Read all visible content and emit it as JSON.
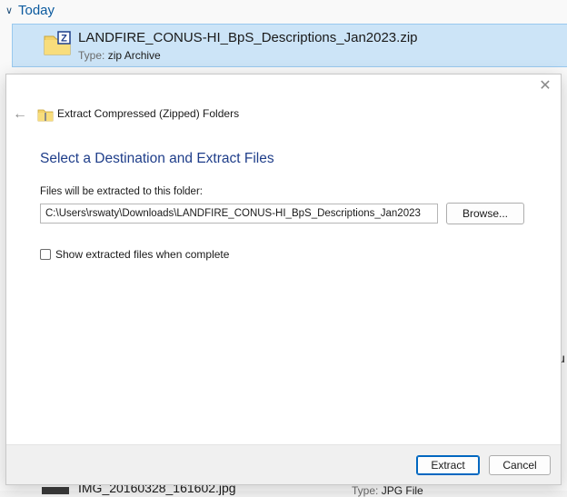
{
  "explorer": {
    "group_header": "Today",
    "selected_file": {
      "name": "LANDFIRE_CONUS-HI_BpS_Descriptions_Jan2023.zip",
      "type_label": "Type:",
      "type_value": "zip Archive"
    },
    "bottom_file": {
      "name": "IMG_20160328_161602.jpg",
      "type_label": "Type:",
      "type_value": "JPG File"
    },
    "edge_glyph": "u"
  },
  "dialog": {
    "nav_title": "Extract Compressed (Zipped) Folders",
    "heading": "Select a Destination and Extract Files",
    "destination_label": "Files will be extracted to this folder:",
    "destination_path": "C:\\Users\\rswaty\\Downloads\\LANDFIRE_CONUS-HI_BpS_Descriptions_Jan2023",
    "browse_label": "Browse...",
    "show_files_label": "Show extracted files when complete",
    "show_files_checked": false,
    "extract_label": "Extract",
    "cancel_label": "Cancel"
  },
  "colors": {
    "selection_bg": "#cce4f7",
    "heading": "#1f3e8a",
    "accent": "#0067c0"
  }
}
